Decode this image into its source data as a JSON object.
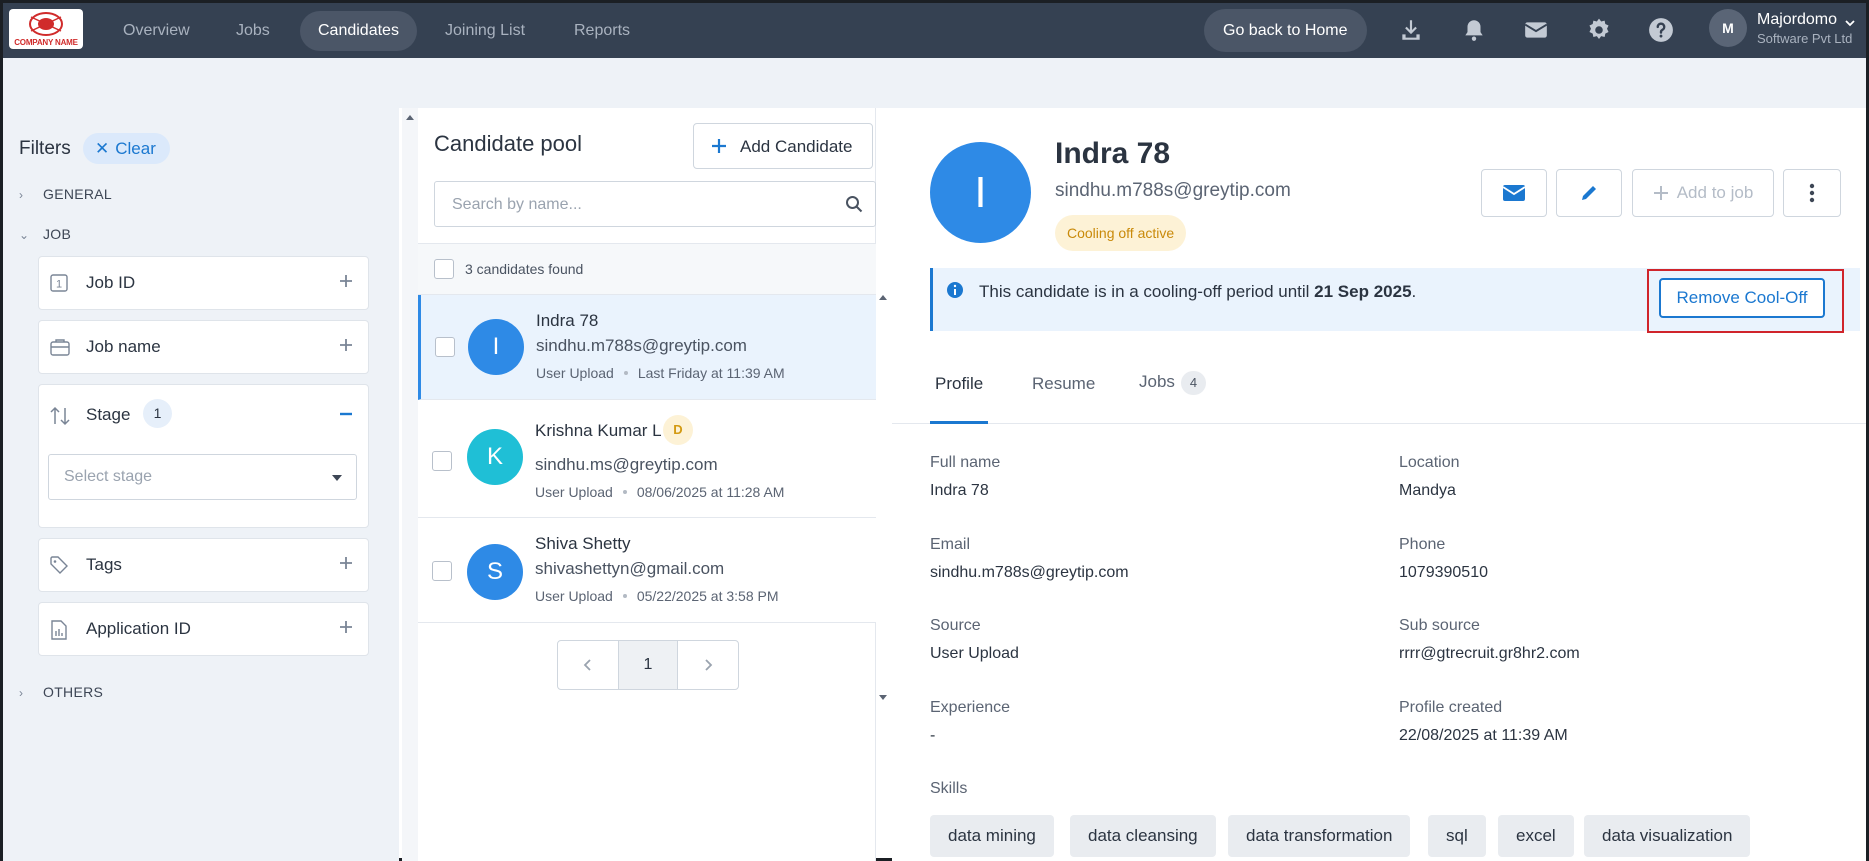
{
  "nav": {
    "logo_text": "COMPANY NAME",
    "items": [
      "Overview",
      "Jobs",
      "Candidates",
      "Joining List",
      "Reports"
    ],
    "active": "Candidates",
    "home_button": "Go back to Home",
    "icons": [
      "download-icon",
      "bell-icon",
      "mail-icon",
      "gear-icon",
      "help-icon"
    ],
    "user": {
      "initial": "M",
      "name": "Majordomo",
      "org": "Software Pvt Ltd"
    }
  },
  "filters": {
    "title": "Filters",
    "clear_label": "Clear",
    "sections": {
      "general": "GENERAL",
      "job": "JOB",
      "others": "OTHERS"
    },
    "job_filters": {
      "job_id": "Job ID",
      "job_name": "Job name",
      "stage": "Stage",
      "stage_count": "1",
      "stage_placeholder": "Select stage",
      "tags": "Tags",
      "application_id": "Application ID"
    }
  },
  "pool": {
    "title": "Candidate pool",
    "add_button": "Add Candidate",
    "search_placeholder": "Search by name...",
    "found_text": "3 candidates found",
    "candidates": [
      {
        "initial": "I",
        "name": "Indra 78",
        "email": "sindhu.m788s@greytip.com",
        "source": "User Upload",
        "time": "Last Friday at 11:39 AM",
        "color": "#2e8ae6"
      },
      {
        "initial": "K",
        "name": "Krishna Kumar L",
        "badge": "D",
        "email": "sindhu.ms@greytip.com",
        "source": "User Upload",
        "time": "08/06/2025 at 11:28 AM",
        "color": "#1fbfd6"
      },
      {
        "initial": "S",
        "name": "Shiva Shetty",
        "email": "shivashettyn@gmail.com",
        "source": "User Upload",
        "time": "05/22/2025 at 3:58 PM",
        "color": "#2e8ae6"
      }
    ],
    "page": "1"
  },
  "detail": {
    "initial": "I",
    "name": "Indra 78",
    "email": "sindhu.m788s@greytip.com",
    "status_badge": "Cooling off active",
    "add_to_job": "Add to job",
    "banner": {
      "text": "This candidate is in a cooling-off period until ",
      "date": "21 Sep 2025",
      "end": "."
    },
    "remove_button": "Remove Cool-Off",
    "tabs": {
      "profile": "Profile",
      "resume": "Resume",
      "jobs": "Jobs",
      "jobs_count": "4"
    },
    "fields": {
      "full_name": {
        "label": "Full name",
        "value": "Indra 78"
      },
      "location": {
        "label": "Location",
        "value": "Mandya"
      },
      "email": {
        "label": "Email",
        "value": "sindhu.m788s@greytip.com"
      },
      "phone": {
        "label": "Phone",
        "value": "1079390510"
      },
      "source": {
        "label": "Source",
        "value": "User Upload"
      },
      "sub_source": {
        "label": "Sub source",
        "value": "rrrr@gtrecruit.gr8hr2.com"
      },
      "experience": {
        "label": "Experience",
        "value": "-"
      },
      "profile_created": {
        "label": "Profile created",
        "value": "22/08/2025 at 11:39 AM"
      }
    },
    "skills_label": "Skills",
    "skills": [
      "data mining",
      "data cleansing",
      "data transformation",
      "sql",
      "excel",
      "data visualization"
    ]
  },
  "colors": {
    "nav_bg": "#354152",
    "accent": "#1b78d0",
    "highlight_outline": "#d0242b",
    "cooling_badge": "#fdf2d6"
  }
}
